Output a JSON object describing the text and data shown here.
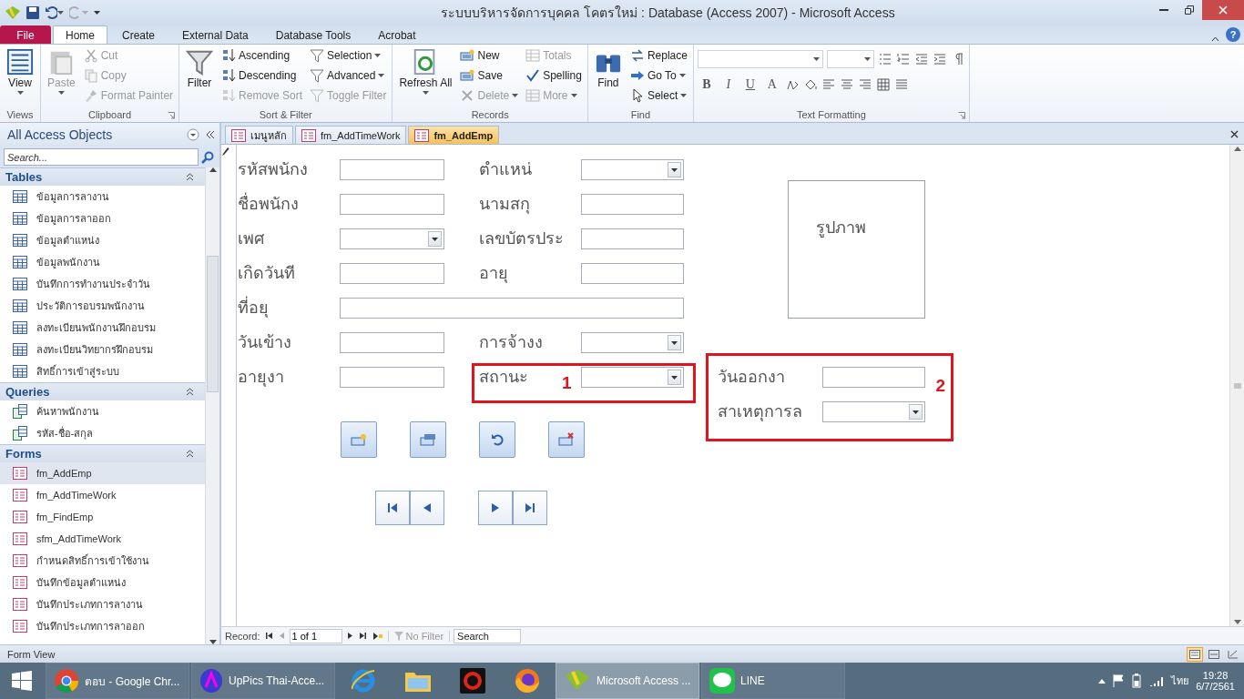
{
  "window": {
    "title": "ระบบบริหารจัดการบุคคล โคตรใหม่ : Database (Access 2007)  -  Microsoft Access"
  },
  "ribbon": {
    "tabs": [
      {
        "label": "File",
        "kind": "file",
        "selected": false
      },
      {
        "label": "Home",
        "kind": "tab",
        "selected": true
      },
      {
        "label": "Create",
        "kind": "tab",
        "selected": false
      },
      {
        "label": "External Data",
        "kind": "tab",
        "selected": false
      },
      {
        "label": "Database Tools",
        "kind": "tab",
        "selected": false
      },
      {
        "label": "Acrobat",
        "kind": "tab",
        "selected": false
      }
    ],
    "help": "?",
    "groups": [
      {
        "label": "Views",
        "kind": "commands",
        "launcher": false,
        "items": [
          {
            "label": "View",
            "kind": "large",
            "dropdown": true,
            "disabled": false
          }
        ]
      },
      {
        "label": "Clipboard",
        "kind": "commands",
        "launcher": true,
        "items": [
          {
            "label": "Paste",
            "kind": "large",
            "dropdown": true,
            "disabled": true
          },
          {
            "label": "Cut",
            "kind": "small",
            "dropdown": false,
            "disabled": true
          },
          {
            "label": "Copy",
            "kind": "small",
            "dropdown": false,
            "disabled": true
          },
          {
            "label": "Format Painter",
            "kind": "small",
            "dropdown": false,
            "disabled": true
          }
        ]
      },
      {
        "label": "Sort & Filter",
        "kind": "commands",
        "launcher": false,
        "items": [
          {
            "label": "Filter",
            "kind": "large",
            "dropdown": false,
            "disabled": false
          },
          {
            "label": "Ascending",
            "kind": "small",
            "dropdown": false,
            "disabled": false
          },
          {
            "label": "Descending",
            "kind": "small",
            "dropdown": false,
            "disabled": false
          },
          {
            "label": "Remove Sort",
            "kind": "small",
            "dropdown": false,
            "disabled": true
          },
          {
            "label": "Selection",
            "kind": "small",
            "dropdown": true,
            "disabled": false
          },
          {
            "label": "Advanced",
            "kind": "small",
            "dropdown": true,
            "disabled": false
          },
          {
            "label": "Toggle Filter",
            "kind": "small",
            "dropdown": false,
            "disabled": true
          }
        ]
      },
      {
        "label": "Records",
        "kind": "commands",
        "launcher": false,
        "items": [
          {
            "label": "Refresh All",
            "kind": "large",
            "dropdown": true,
            "disabled": false
          },
          {
            "label": "New",
            "kind": "small",
            "dropdown": false,
            "disabled": false
          },
          {
            "label": "Save",
            "kind": "small",
            "dropdown": false,
            "disabled": false
          },
          {
            "label": "Delete",
            "kind": "small",
            "dropdown": true,
            "disabled": true
          },
          {
            "label": "Totals",
            "kind": "small",
            "dropdown": false,
            "disabled": true
          },
          {
            "label": "Spelling",
            "kind": "small",
            "dropdown": false,
            "disabled": false
          },
          {
            "label": "More",
            "kind": "small",
            "dropdown": true,
            "disabled": true
          }
        ]
      },
      {
        "label": "Find",
        "kind": "commands",
        "launcher": false,
        "items": [
          {
            "label": "Find",
            "kind": "large",
            "dropdown": false,
            "disabled": false
          },
          {
            "label": "Replace",
            "kind": "small",
            "dropdown": false,
            "disabled": false
          },
          {
            "label": "Go To",
            "kind": "small",
            "dropdown": true,
            "disabled": false
          },
          {
            "label": "Select",
            "kind": "small",
            "dropdown": true,
            "disabled": false
          }
        ]
      },
      {
        "label": "Text Formatting",
        "kind": "formatting",
        "launcher": true,
        "letters": [
          "B",
          "I",
          "U",
          "A"
        ]
      }
    ]
  },
  "nav": {
    "title": "All Access Objects",
    "search_placeholder": "Search...",
    "sections": [
      {
        "title": "Tables",
        "kind": "table",
        "items": [
          {
            "label": "ข้อมูลการลางาน",
            "selected": false
          },
          {
            "label": "ข้อมูลการลาออก",
            "selected": false
          },
          {
            "label": "ข้อมูลตำแหน่ง",
            "selected": false
          },
          {
            "label": "ข้อมูลพนักงาน",
            "selected": false
          },
          {
            "label": "บันทึกการทำงานประจำวัน",
            "selected": false
          },
          {
            "label": "ประวัติการอบรมพนักงาน",
            "selected": false
          },
          {
            "label": "ลงทะเบียนพนักงานฝึกอบรม",
            "selected": false
          },
          {
            "label": "ลงทะเบียนวิทยากรฝึกอบรม",
            "selected": false
          },
          {
            "label": "สิทธิ์การเข้าสู่ระบบ",
            "selected": false
          }
        ]
      },
      {
        "title": "Queries",
        "kind": "query",
        "items": [
          {
            "label": "ค้นหาพนักงาน",
            "selected": false
          },
          {
            "label": "รหัส-ชื่อ-สกุล",
            "selected": false
          }
        ]
      },
      {
        "title": "Forms",
        "kind": "form",
        "items": [
          {
            "label": "fm_AddEmp",
            "selected": true
          },
          {
            "label": "fm_AddTimeWork",
            "selected": false
          },
          {
            "label": "fm_FindEmp",
            "selected": false
          },
          {
            "label": "sfm_AddTimeWork",
            "selected": false
          },
          {
            "label": "กำหนดสิทธิ์การเข้าใช้งาน",
            "selected": false
          },
          {
            "label": "บันทึกข้อมูลตำแหน่ง",
            "selected": false
          },
          {
            "label": "บันทึกประเภทการลางาน",
            "selected": false
          },
          {
            "label": "บันทึกประเภทการลาออก",
            "selected": false
          }
        ]
      }
    ]
  },
  "doc_tabs": [
    {
      "label": "เมนูหลัก",
      "selected": false
    },
    {
      "label": "fm_AddTimeWork",
      "selected": false
    },
    {
      "label": "fm_AddEmp",
      "selected": true
    }
  ],
  "form": {
    "rows": [
      [
        {
          "label": "รหัสพนักง",
          "kind": "text"
        },
        {
          "label": "ตำแหน่",
          "kind": "combo"
        }
      ],
      [
        {
          "label": "ชื่อพนักง",
          "kind": "text"
        },
        {
          "label": "นามสกุ",
          "kind": "text"
        }
      ],
      [
        {
          "label": "เพศ",
          "kind": "combo"
        },
        {
          "label": "เลขบัตรประ",
          "kind": "text"
        }
      ],
      [
        {
          "label": "เกิดวันที",
          "kind": "text"
        },
        {
          "label": "อายุ",
          "kind": "text"
        }
      ],
      [
        {
          "label": "ที่อยุ",
          "kind": "wide"
        }
      ],
      [
        {
          "label": "วันเข้าง",
          "kind": "text"
        },
        {
          "label": "การจ้างง",
          "kind": "combo"
        }
      ],
      [
        {
          "label": "อายุงา",
          "kind": "text"
        },
        {
          "label": "สถานะ",
          "kind": "combo"
        }
      ]
    ],
    "photo_label": "รูปภาพ",
    "exit_fields": [
      {
        "label": "วันออกงา",
        "kind": "text"
      },
      {
        "label": "สาเหตุการล",
        "kind": "combo"
      }
    ],
    "callouts": [
      "1",
      "2"
    ]
  },
  "record_bar": {
    "label": "Record:",
    "position": "1 of 1",
    "filter": "No Filter",
    "search_placeholder": "Search"
  },
  "status_bar": {
    "text": "Form View"
  },
  "taskbar": {
    "items": [
      {
        "label": "ตอบ - Google Chr...",
        "kind": "app",
        "selected": false
      },
      {
        "label": "UpPics Thai-Acce...",
        "kind": "app",
        "selected": false
      },
      {
        "kind": "pinned",
        "selected": false
      },
      {
        "kind": "pinned",
        "selected": false
      },
      {
        "kind": "pinned",
        "selected": false
      },
      {
        "kind": "pinned",
        "selected": false
      },
      {
        "label": "Microsoft Access ...",
        "kind": "app",
        "selected": true
      },
      {
        "label": "LINE",
        "kind": "app",
        "selected": false
      }
    ],
    "language": "ไทย",
    "time": "19:28",
    "date": "6/7/2561"
  }
}
